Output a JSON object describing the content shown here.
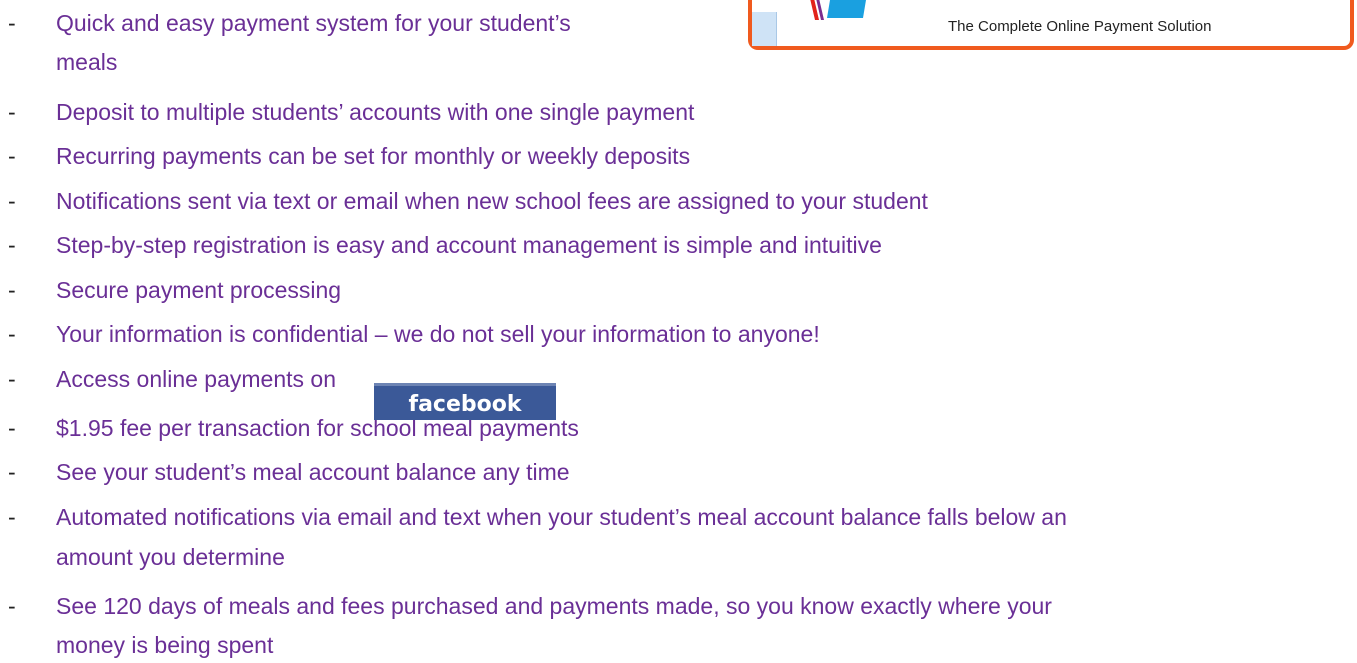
{
  "banner": {
    "tagline": "The Complete Online Payment Solution"
  },
  "bullet": "-",
  "items": [
    {
      "line1": "Quick and easy payment system for your student’s",
      "line2": "meals"
    },
    {
      "line1": "Deposit to multiple students’ accounts with one single payment"
    },
    {
      "line1": "Recurring payments can be set for monthly or weekly deposits"
    },
    {
      "line1": "Notifications sent via text or email when new school fees are assigned to your student"
    },
    {
      "line1": "Step-by-step registration is easy and account management is simple and intuitive"
    },
    {
      "line1": "Secure payment processing"
    },
    {
      "line1": "Your information is confidential – we do not sell your information to anyone!"
    },
    {
      "line1": "Access online payments on"
    },
    {
      "line1": "$1.95 fee per transaction for school meal payments"
    },
    {
      "line1": "See your student’s meal account balance any time"
    },
    {
      "line1": "Automated notifications via email and text when your student’s meal account balance falls below an",
      "line2": "amount you determine"
    },
    {
      "line1": "See 120 days of meals and fees purchased and payments made, so you know exactly where your",
      "line2": "money is being spent"
    }
  ],
  "facebook": {
    "label": "facebook",
    "color": "#3b5998"
  },
  "colors": {
    "text": "#6a2f96",
    "banner_border": "#f05a1e"
  }
}
